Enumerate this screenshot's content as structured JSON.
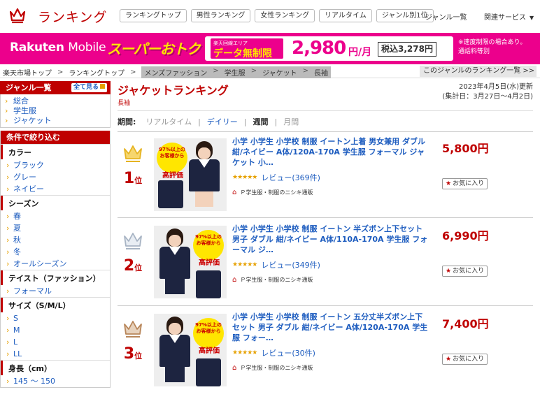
{
  "header": {
    "brand": "ランキング",
    "nav": [
      "ランキングトップ",
      "男性ランキング",
      "女性ランキング",
      "リアルタイム",
      "ジャンル別1位"
    ],
    "genre_list_link": "ジャンル一覧",
    "related_link": "関連サービス"
  },
  "banner": {
    "logo_main": "Rakuten",
    "logo_sub": "Mobile",
    "headline": "スーパーおトク",
    "area_note": "楽天回線エリア",
    "plan": "データ無制限",
    "price": "2,980",
    "price_unit": "円/月",
    "tax_price": "税込3,278円",
    "notes": [
      "※速度制限の場合あり。",
      "通話料等別"
    ]
  },
  "breadcrumb": {
    "items": [
      "楽天市場トップ",
      "ランキングトップ"
    ],
    "highlighted": [
      "メンズファッション",
      "学生服",
      "ジャケット",
      "長袖"
    ],
    "right_link": "このジャンルのランキング一覧 >>"
  },
  "sidebar": {
    "genre_title": "ジャンル一覧",
    "show_all": "全て見る",
    "genres": [
      "総合",
      "学生服",
      "ジャケット"
    ],
    "filter_title": "条件で絞り込む",
    "groups": [
      {
        "title": "カラー",
        "items": [
          "ブラック",
          "グレー",
          "ネイビー"
        ]
      },
      {
        "title": "シーズン",
        "items": [
          "春",
          "夏",
          "秋",
          "冬",
          "オールシーズン"
        ]
      },
      {
        "title": "テイスト（ファッション）",
        "items": [
          "フォーマル"
        ]
      },
      {
        "title": "サイズ（S/M/L）",
        "items": [
          "S",
          "M",
          "L",
          "LL"
        ]
      },
      {
        "title": "身長（cm）",
        "items": [
          "145 ～ 150"
        ]
      }
    ]
  },
  "main": {
    "title": "ジャケットランキング",
    "subtitle": "長袖",
    "updated": "2023年4月5日(水)更新",
    "period_range": "(集計日：3月27日～4月2日)",
    "period_label": "期間:",
    "periods": [
      "リアルタイム",
      "デイリー",
      "週間",
      "月間"
    ],
    "active_period": "週間"
  },
  "products": [
    {
      "rank": "1",
      "rank_suffix": "位",
      "title": "小学 小学生 小学校 制服 イートン上着 男女兼用 ダブル 紺/ネイビー A体/120A-170A 学生服 フォーマル ジャケット 小…",
      "reviews": "レビュー(369件)",
      "shop": "Ｐ学生服・制服のニシキ通販",
      "price": "5,800円",
      "fav": "お気に入り",
      "badge_text": "97%以上のお客様から",
      "badge_main": "高評価",
      "crown_color": "#e6b422"
    },
    {
      "rank": "2",
      "rank_suffix": "位",
      "title": "小学 小学生 小学校 制服 イートン 半ズボン上下セット 男子 ダブル 紺/ネイビー A体/110A-170A 学生服 フォーマル ジ…",
      "reviews": "レビュー(349件)",
      "shop": "Ｐ学生服・制服のニシキ通販",
      "price": "6,990円",
      "fav": "お気に入り",
      "badge_text": "97%以上のお客様から",
      "badge_main": "高評価",
      "crown_color": "#a8b4c4"
    },
    {
      "rank": "3",
      "rank_suffix": "位",
      "title": "小学 小学生 小学校 制服 イートン 五分丈半ズボン上下セット 男子 ダブル 紺/ネイビー A体/120A-170A 学生服 フォー…",
      "reviews": "レビュー(30件)",
      "shop": "Ｐ学生服・制服のニシキ通販",
      "price": "7,400円",
      "fav": "お気に入り",
      "badge_text": "97%以上のお客様から",
      "badge_main": "高評価",
      "crown_color": "#b8865a"
    }
  ],
  "colors": {
    "rakuten_red": "#bf0000",
    "banner_pink": "#ec008c",
    "link_blue": "#1d5cbf"
  }
}
